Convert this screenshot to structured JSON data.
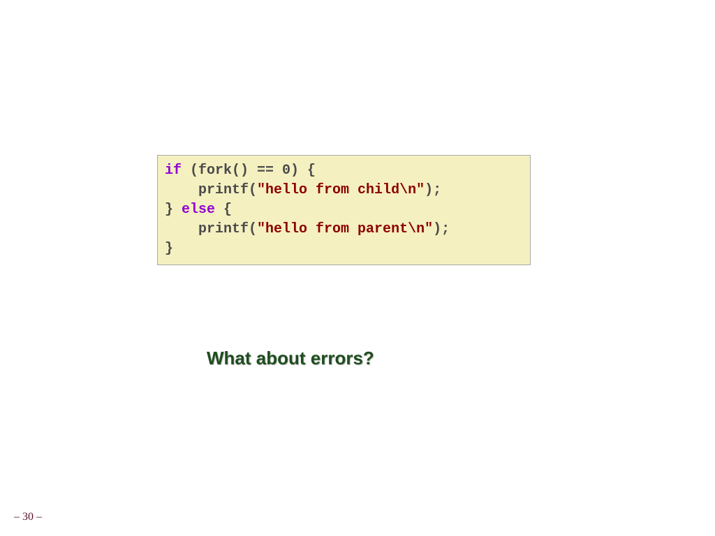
{
  "code": {
    "line1": {
      "kw": "if",
      "rest": " (fork() == 0) {"
    },
    "line2": {
      "indent": "    printf(",
      "str": "\"hello from child\\n\"",
      "rest": ");"
    },
    "line3": {
      "before": "} ",
      "kw": "else",
      "rest": " {"
    },
    "line4": {
      "indent": "    printf(",
      "str": "\"hello from parent\\n\"",
      "rest": ");"
    },
    "line5": "}"
  },
  "heading": "What about errors?",
  "page_number": "– 30 –"
}
